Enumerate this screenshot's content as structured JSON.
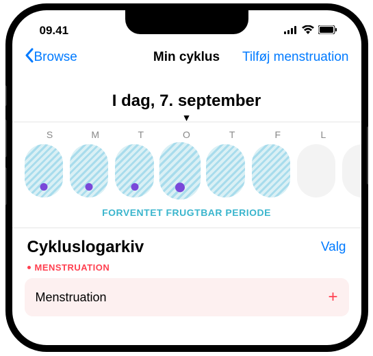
{
  "statusBar": {
    "time": "09.41"
  },
  "nav": {
    "back": "Browse",
    "title": "Min cyklus",
    "action": "Tilføj menstruation"
  },
  "dateHeading": "I dag, 7. september",
  "weekDays": [
    "S",
    "M",
    "T",
    "O",
    "T",
    "F",
    "L"
  ],
  "fertileLabel": "FORVENTET FRUGTBAR PERIODE",
  "log": {
    "title": "Cykluslogarkiv",
    "options": "Valg",
    "categoryLabel": "MENSTRUATION",
    "item": "Menstruation"
  }
}
